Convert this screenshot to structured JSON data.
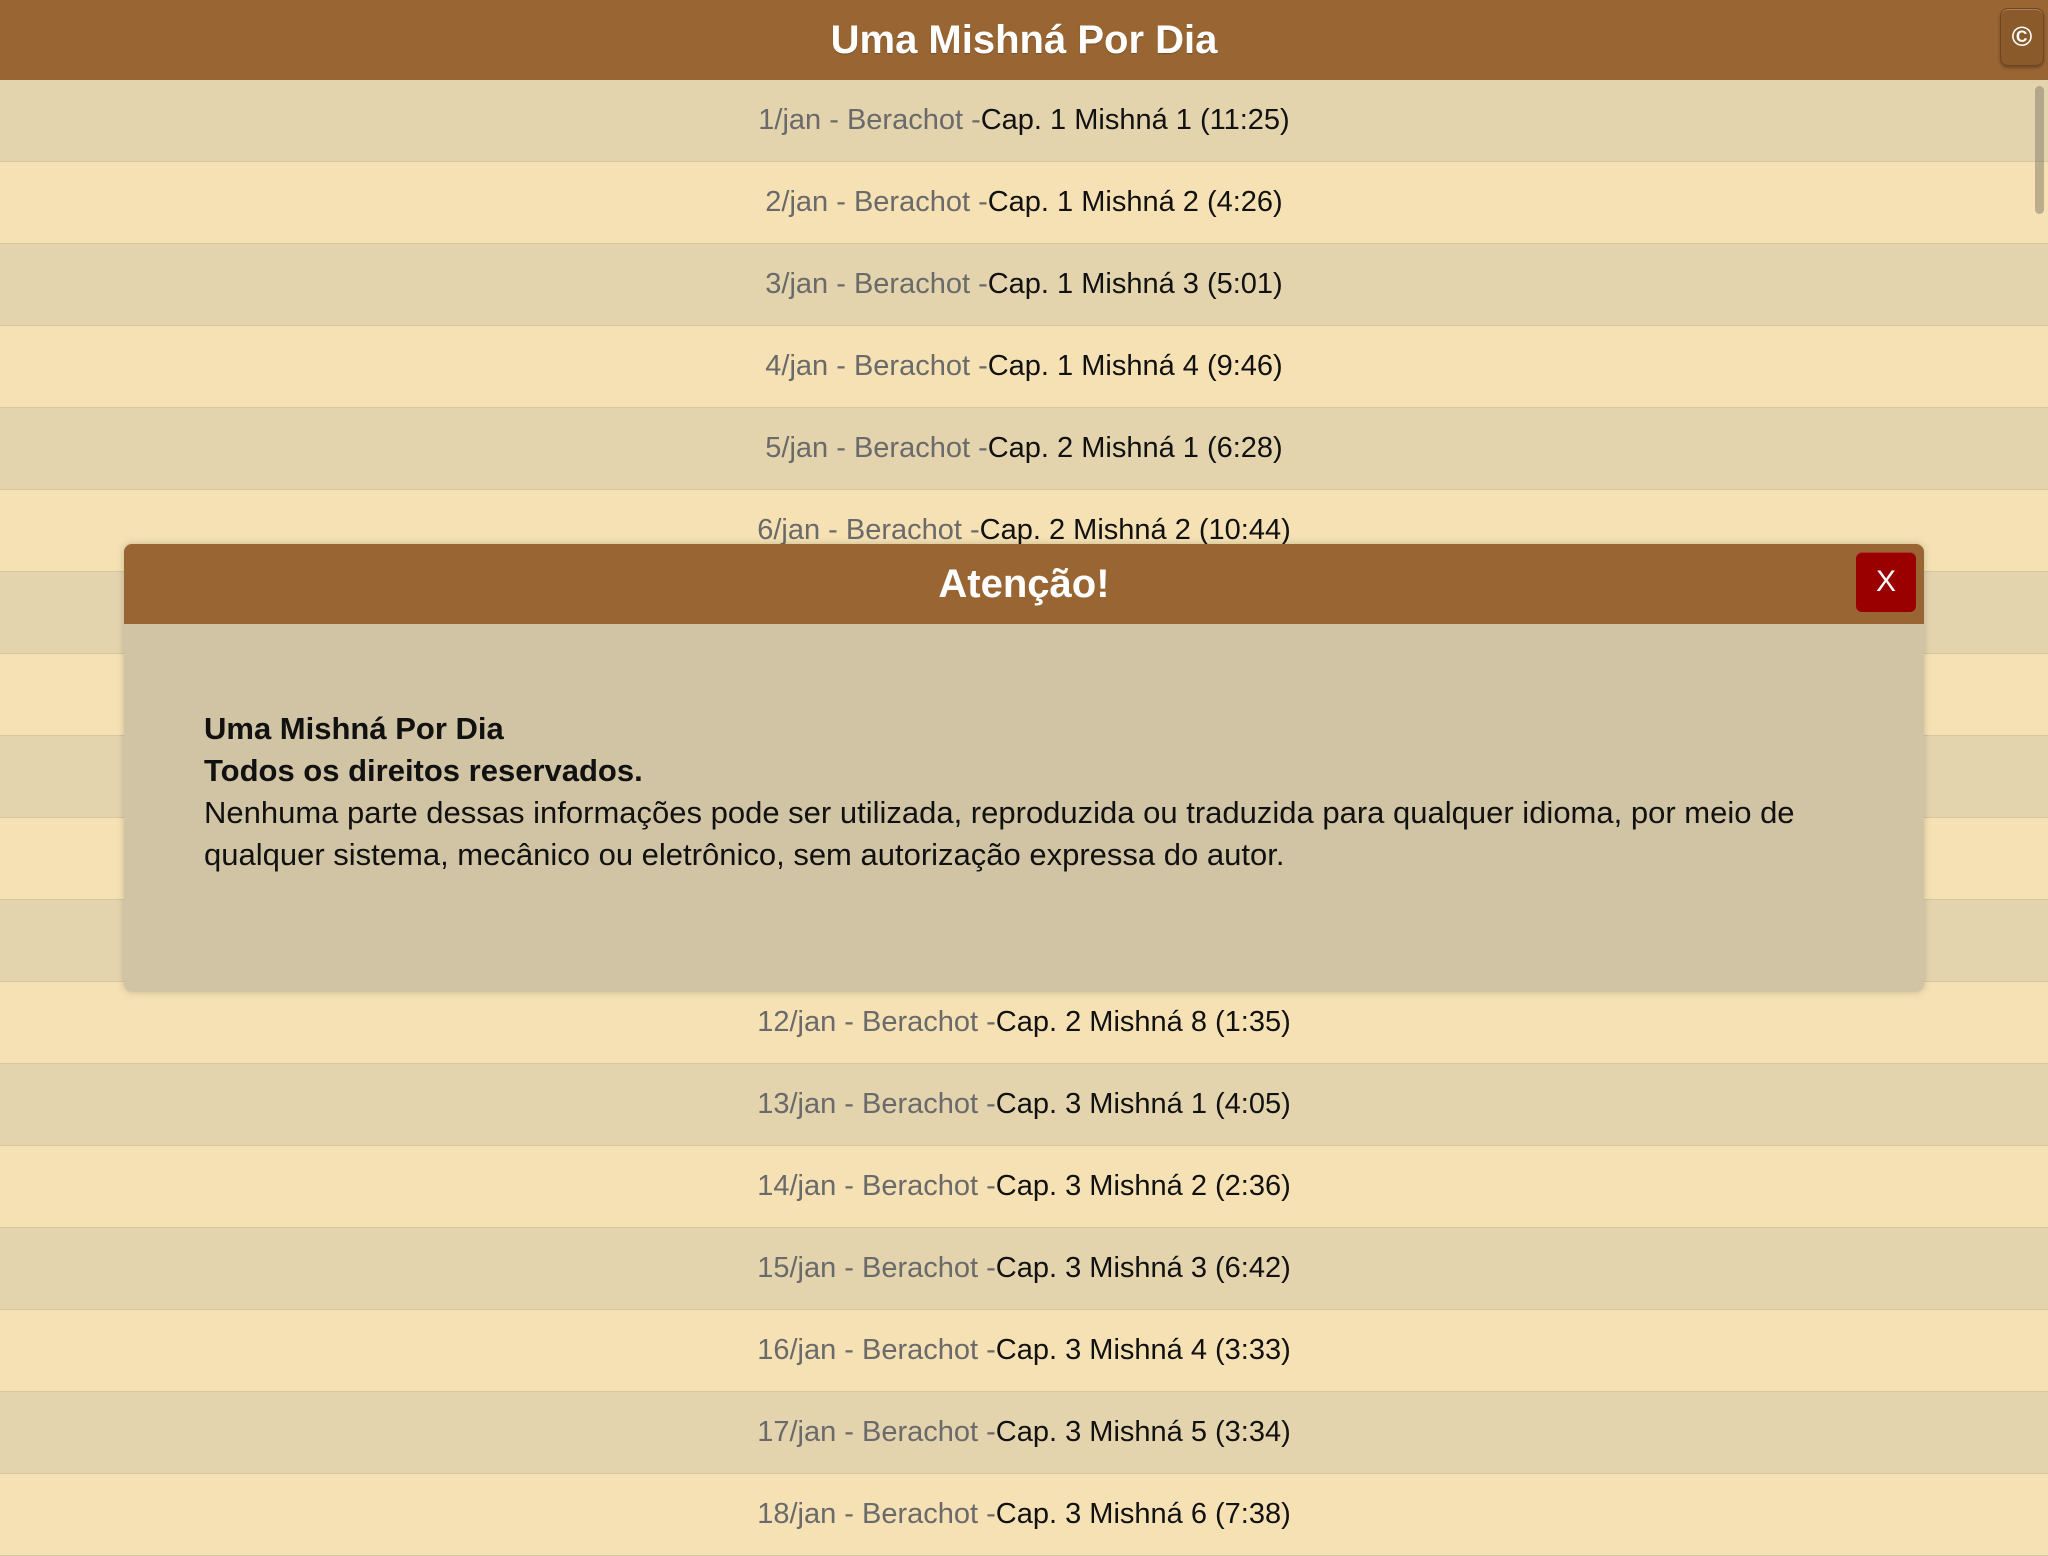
{
  "header": {
    "title": "Uma Mishná Por Dia",
    "copyright_icon": "©"
  },
  "rows": [
    {
      "date": "1/jan - Berachot - ",
      "text": "Cap. 1 Mishná 1 (11:25)"
    },
    {
      "date": "2/jan - Berachot - ",
      "text": "Cap. 1 Mishná 2 (4:26)"
    },
    {
      "date": "3/jan - Berachot - ",
      "text": "Cap. 1 Mishná 3 (5:01)"
    },
    {
      "date": "4/jan - Berachot - ",
      "text": "Cap. 1 Mishná 4 (9:46)"
    },
    {
      "date": "5/jan - Berachot - ",
      "text": "Cap. 2 Mishná 1 (6:28)"
    },
    {
      "date": "6/jan - Berachot - ",
      "text": "Cap. 2 Mishná 2 (10:44)"
    },
    {
      "date": "",
      "text": ""
    },
    {
      "date": "",
      "text": ""
    },
    {
      "date": "",
      "text": ""
    },
    {
      "date": "",
      "text": ""
    },
    {
      "date": "",
      "text": ""
    },
    {
      "date": "12/jan - Berachot - ",
      "text": "Cap. 2 Mishná 8 (1:35)"
    },
    {
      "date": "13/jan - Berachot - ",
      "text": "Cap. 3 Mishná 1 (4:05)"
    },
    {
      "date": "14/jan - Berachot - ",
      "text": "Cap. 3 Mishná 2 (2:36)"
    },
    {
      "date": "15/jan - Berachot - ",
      "text": "Cap. 3 Mishná 3 (6:42)"
    },
    {
      "date": "16/jan - Berachot - ",
      "text": "Cap. 3 Mishná 4 (3:33)"
    },
    {
      "date": "17/jan - Berachot - ",
      "text": "Cap. 3 Mishná 5 (3:34)"
    },
    {
      "date": "18/jan - Berachot - ",
      "text": "Cap. 3 Mishná 6 (7:38)"
    }
  ],
  "modal": {
    "title": "Atenção!",
    "close_label": "X",
    "app_name": "Uma Mishná Por Dia",
    "rights": "Todos os direitos reservados.",
    "notice": "Nenhuma parte dessas informações pode ser utilizada, reproduzida ou traduzida para qualquer idioma, por meio de qualquer sistema, mecânico ou eletrônico, sem autorização expressa do autor."
  },
  "colors": {
    "brand_brown": "#996633",
    "row_light": "#f5e1b3",
    "row_dark": "#e3d4ae",
    "modal_bg": "#d1c4a4",
    "close_red": "#9b0000"
  }
}
